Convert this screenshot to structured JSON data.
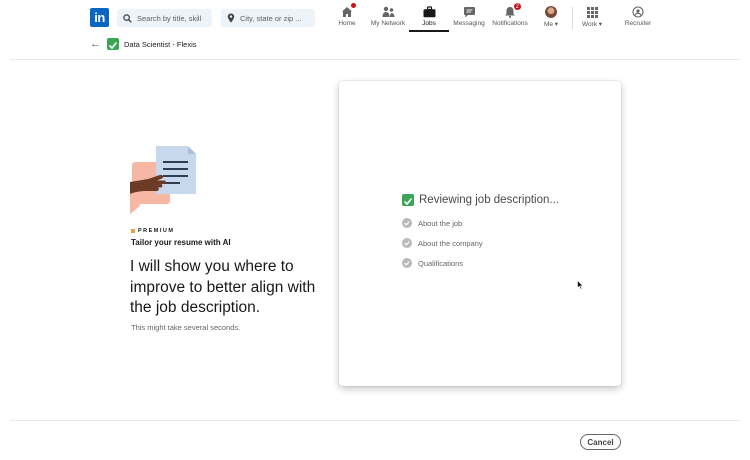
{
  "nav": {
    "logo_text": "in",
    "search_keywords_placeholder": "Search by title, skill",
    "search_location_placeholder": "City, state or zip ...",
    "items": [
      {
        "label": "Home",
        "icon": "home-icon",
        "badge": ""
      },
      {
        "label": "My Network",
        "icon": "network-icon",
        "badge": ""
      },
      {
        "label": "Jobs",
        "icon": "briefcase-icon",
        "badge": ""
      },
      {
        "label": "Messaging",
        "icon": "messaging-icon",
        "badge": ""
      },
      {
        "label": "Notifications",
        "icon": "bell-icon",
        "badge": "2"
      },
      {
        "label": "Me ▾",
        "icon": "avatar",
        "badge": ""
      },
      {
        "label": "Work ▾",
        "icon": "grid-icon",
        "badge": ""
      },
      {
        "label": "Recruiter",
        "icon": "recruiter-icon",
        "badge": ""
      }
    ],
    "active_item": "Jobs"
  },
  "subheader": {
    "job_title": "Data Scientist - Flexis"
  },
  "left": {
    "premium_label": "PREMIUM",
    "feature_title": "Tailor your resume with AI",
    "headline": "I will show you where to improve to better align with the job description.",
    "hint": "This might take several seconds."
  },
  "card": {
    "status_text": "Reviewing job description...",
    "steps": [
      "About the job",
      "About the company",
      "Qualifications"
    ]
  },
  "footer": {
    "cancel_label": "Cancel"
  },
  "colors": {
    "brand": "#0a66c2",
    "success": "#3aa654",
    "premium": "#e7a33e",
    "badge": "#cc1016"
  }
}
